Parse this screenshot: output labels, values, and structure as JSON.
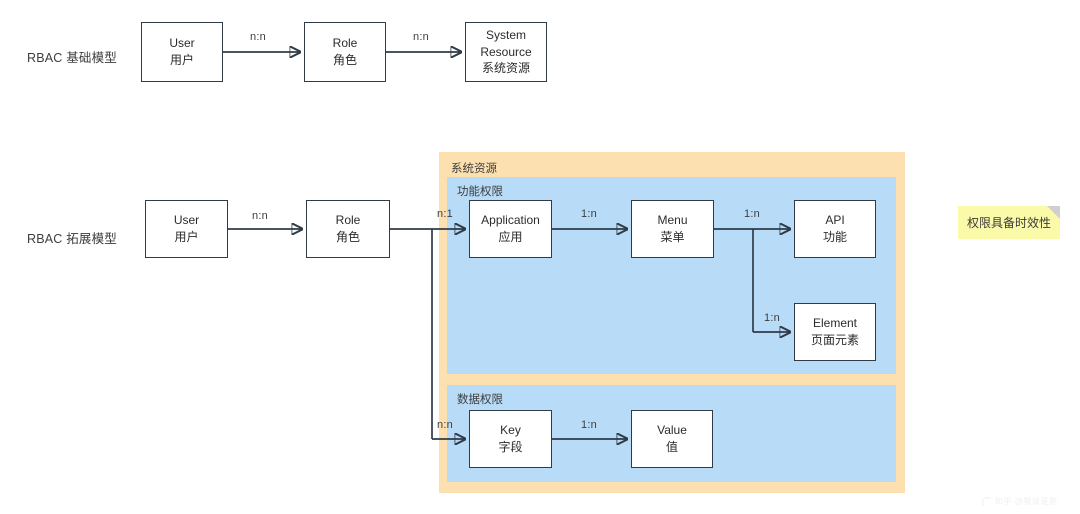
{
  "diagram": {
    "rows": [
      {
        "id": "basic",
        "label": "RBAC 基础模型"
      },
      {
        "id": "extended",
        "label": "RBAC 拓展模型"
      }
    ],
    "basic_model": {
      "nodes": [
        {
          "id": "user",
          "en": "User",
          "zh": "用户"
        },
        {
          "id": "role",
          "en": "Role",
          "zh": "角色"
        },
        {
          "id": "sysres",
          "en": "System",
          "en2": "Resource",
          "zh": "系统资源"
        }
      ],
      "edges": [
        {
          "from": "user",
          "to": "role",
          "label": "n:n"
        },
        {
          "from": "role",
          "to": "sysres",
          "label": "n:n"
        }
      ]
    },
    "extended_model": {
      "nodes": [
        {
          "id": "user2",
          "en": "User",
          "zh": "用户"
        },
        {
          "id": "role2",
          "en": "Role",
          "zh": "角色"
        }
      ],
      "edges": [
        {
          "from": "user2",
          "to": "role2",
          "label": "n:n"
        },
        {
          "from": "role2",
          "to": "application",
          "label": "n:1"
        },
        {
          "from": "role2",
          "to": "key",
          "label": "n:n"
        }
      ]
    },
    "system_resource_panel": {
      "title": "系统资源",
      "groups": [
        {
          "id": "function-permission",
          "title": "功能权限",
          "nodes": [
            {
              "id": "application",
              "en": "Application",
              "zh": "应用"
            },
            {
              "id": "menu",
              "en": "Menu",
              "zh": "菜单"
            },
            {
              "id": "api",
              "en": "API",
              "zh": "功能"
            },
            {
              "id": "element",
              "en": "Element",
              "zh": "页面元素"
            }
          ],
          "edges": [
            {
              "from": "application",
              "to": "menu",
              "label": "1:n"
            },
            {
              "from": "menu",
              "to": "api",
              "label": "1:n"
            },
            {
              "from": "menu",
              "to": "element",
              "label": "1:n"
            }
          ]
        },
        {
          "id": "data-permission",
          "title": "数据权限",
          "nodes": [
            {
              "id": "key",
              "en": "Key",
              "zh": "字段"
            },
            {
              "id": "value",
              "en": "Value",
              "zh": "值"
            }
          ],
          "edges": [
            {
              "from": "key",
              "to": "value",
              "label": "1:n"
            }
          ]
        }
      ]
    },
    "note": {
      "text": "权限具备时效性"
    },
    "watermark": {
      "text": "知乎 @我就是我"
    },
    "colors": {
      "panel_orange": "#fce0b0",
      "panel_blue": "#b8dcf8",
      "note_yellow": "#fbfaa8",
      "box_border": "#2f3b47",
      "text": "#333333"
    }
  }
}
